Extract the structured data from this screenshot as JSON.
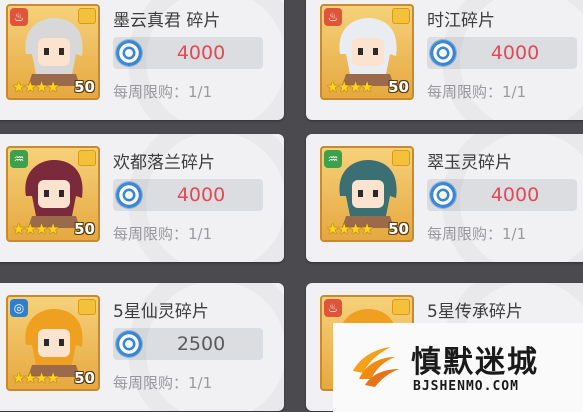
{
  "currency_icon": "crystal-coin-icon",
  "colors": {
    "price_red": "#e04a55",
    "price_neutral": "#5a5a5a",
    "portrait_gold": "#e6a840",
    "star_yellow": "#ffd21f"
  },
  "cards": [
    {
      "name": "墨云真君 碎片",
      "price": "4000",
      "limit": "每周限购：1/1",
      "level": "50",
      "stars": "★★★★",
      "element_icon": "fire-element-icon",
      "element_color": "#e0543a",
      "element_glyph": "♨",
      "hair": "#d8d8d8",
      "price_style": "red"
    },
    {
      "name": "时江碎片",
      "price": "4000",
      "limit": "每周限购：1/1",
      "level": "50",
      "stars": "★★★★",
      "element_icon": "fire-element-icon",
      "element_color": "#e0543a",
      "element_glyph": "♨",
      "hair": "#e9edf2",
      "price_style": "red"
    },
    {
      "name": "欢都落兰碎片",
      "price": "4000",
      "limit": "每周限购：1/1",
      "level": "50",
      "stars": "★★★★",
      "element_icon": "wood-element-icon",
      "element_color": "#3ea04a",
      "element_glyph": "♒",
      "hair": "#7a2a3a",
      "price_style": "red"
    },
    {
      "name": "翠玉灵碎片",
      "price": "4000",
      "limit": "每周限购：1/1",
      "level": "50",
      "stars": "★★★★",
      "element_icon": "wood-element-icon",
      "element_color": "#3ea04a",
      "element_glyph": "♒",
      "hair": "#3a6f74",
      "price_style": "red"
    },
    {
      "name": "5星仙灵碎片",
      "price": "2500",
      "limit": "每周限购：1/1",
      "level": "50",
      "stars": "★★★★",
      "element_icon": "water-element-icon",
      "element_color": "#2f7fd0",
      "element_glyph": "◎",
      "hair": "#f0a020",
      "price_style": "neutral"
    },
    {
      "name": "5星传承碎片",
      "price": "",
      "limit": "",
      "level": "",
      "stars": "",
      "element_icon": "fire-element-icon",
      "element_color": "#e0543a",
      "element_glyph": "♨",
      "hair": "#f0a020",
      "price_style": "neutral"
    }
  ],
  "watermark": {
    "name": "慎默迷城",
    "url": "BJSHENMO.COM",
    "logo_icon": "flame-logo-icon"
  }
}
